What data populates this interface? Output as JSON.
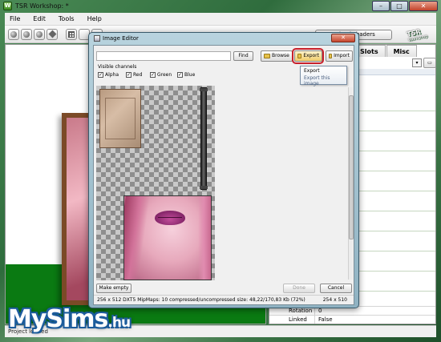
{
  "app": {
    "title": "TSR Workshop: *"
  },
  "window_controls": {
    "minimize": "–",
    "maximize": "□",
    "close": "✕"
  },
  "menu": [
    "File",
    "Edit",
    "Tools",
    "Help"
  ],
  "toolbar": {
    "reload_label": "Reload shaders"
  },
  "tsr_logo": {
    "name": "TSR",
    "sub": "Workshop"
  },
  "right_panel": {
    "tabs": [
      "Slots",
      "Misc"
    ],
    "properties": [
      {
        "key": "Rotation",
        "value": "0"
      },
      {
        "key": "Linked",
        "value": "False"
      }
    ]
  },
  "status": {
    "text": "Project loaded"
  },
  "dialog": {
    "title": "Image Editor",
    "find_label": "Find",
    "browse_label": "Browse",
    "export_label": "Export",
    "import_label": "Import",
    "tooltip": {
      "title": "Export",
      "subtitle": "Export this image"
    },
    "visible_channels_label": "Visible channels",
    "channels": [
      {
        "label": "Alpha",
        "checked": true
      },
      {
        "label": "Red",
        "checked": true
      },
      {
        "label": "Green",
        "checked": true
      },
      {
        "label": "Blue",
        "checked": true
      }
    ],
    "make_empty_label": "Make empty",
    "done_label": "Done",
    "cancel_label": "Cancel",
    "status_info": "256 x 512 DXT5 MipMaps: 10 compressed/uncompressed size: 48,22/170,83 Kb (72%)",
    "status_dims": "254 x 510"
  },
  "watermark": {
    "brand": "MySims",
    "domain": ".hu"
  },
  "colors": {
    "accent_green": "#0a7a12",
    "export_highlight": "#c8202a"
  }
}
